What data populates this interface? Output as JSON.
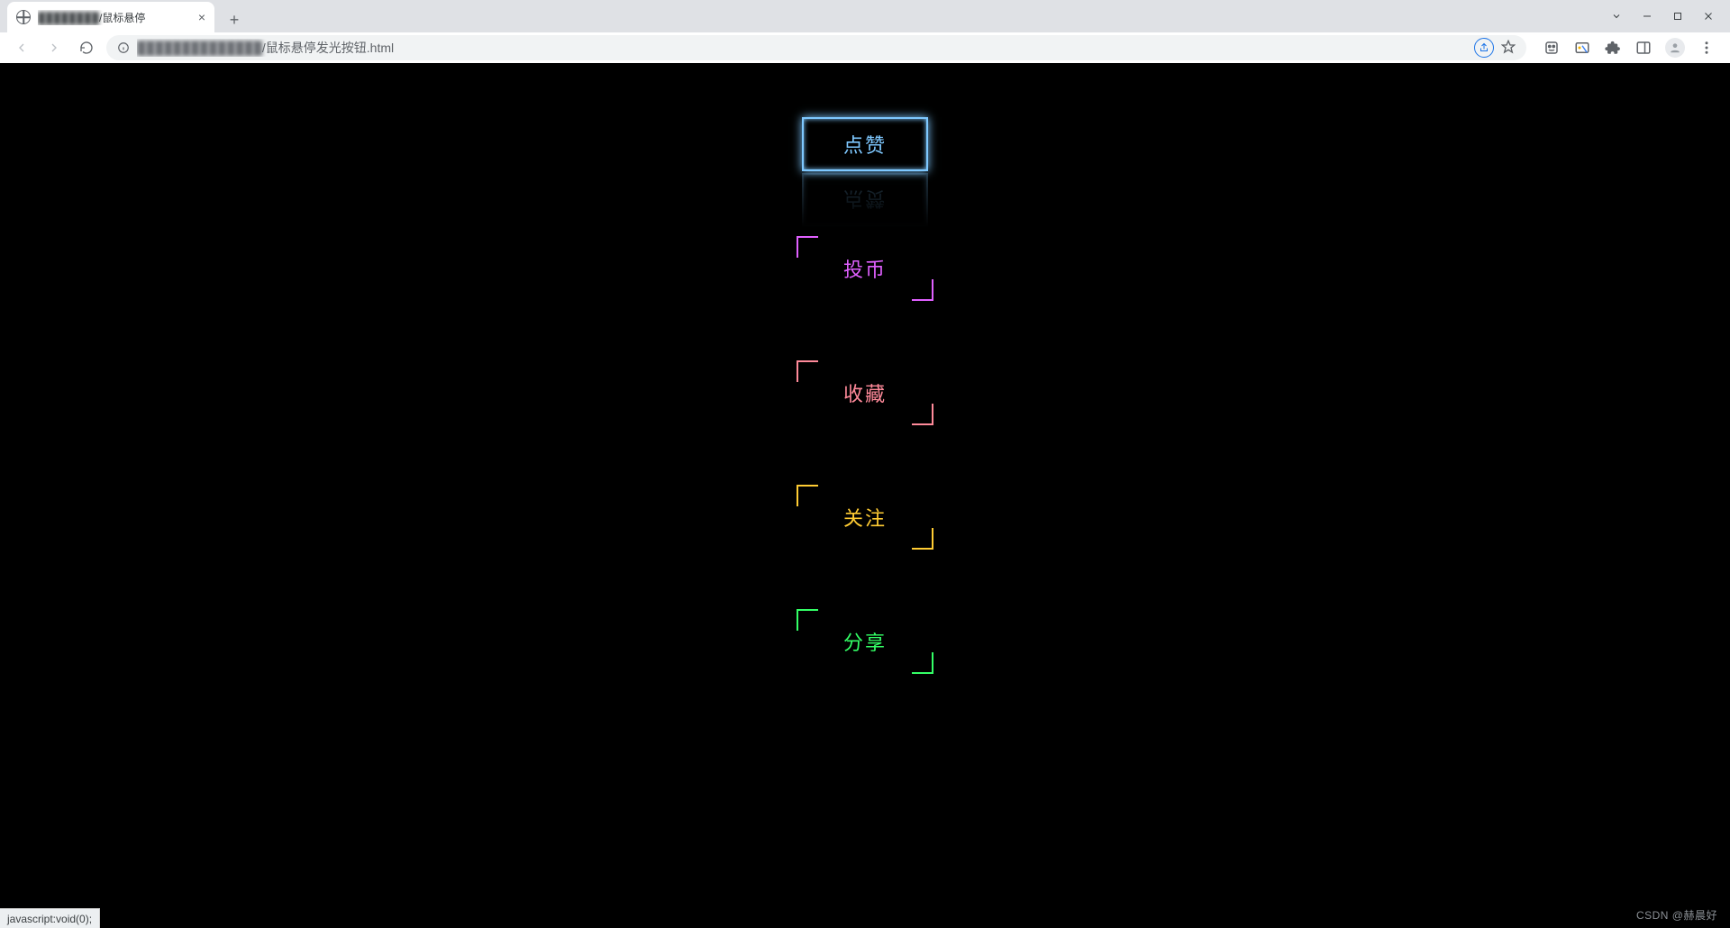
{
  "browser": {
    "tab": {
      "title_suffix": "/鼠标悬停",
      "close_glyph": "×"
    },
    "new_tab_glyph": "+",
    "nav": {
      "back": "back",
      "forward": "forward",
      "reload": "reload"
    },
    "omnibox": {
      "url_suffix": "/鼠标悬停发光按钮.html"
    },
    "window_controls": {
      "caret": "⌄",
      "minimize": "—",
      "maximize": "▢",
      "close": "✕"
    }
  },
  "page": {
    "buttons": [
      {
        "label": "点赞",
        "color_class": "c1",
        "active": true
      },
      {
        "label": "投币",
        "color_class": "c2",
        "active": false
      },
      {
        "label": "收藏",
        "color_class": "c3",
        "active": false
      },
      {
        "label": "关注",
        "color_class": "c4",
        "active": false
      },
      {
        "label": "分享",
        "color_class": "c5",
        "active": false
      }
    ],
    "status_text": "javascript:void(0);",
    "watermark": "CSDN @赫晨好"
  }
}
